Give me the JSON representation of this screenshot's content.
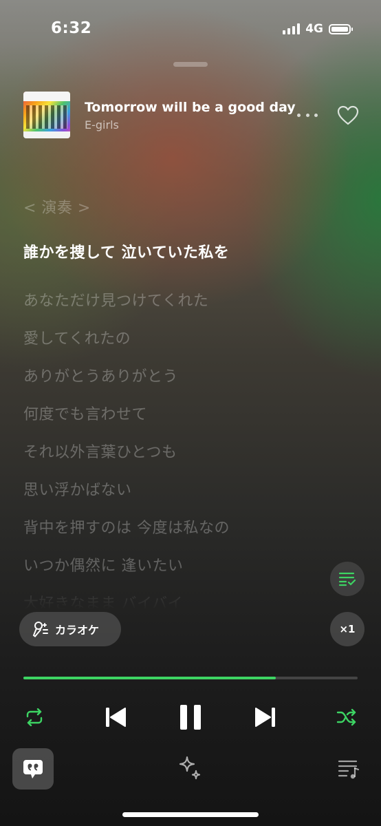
{
  "status_bar": {
    "time": "6:32",
    "network": "4G"
  },
  "track": {
    "title": "Tomorrow will be a good day",
    "artist": "E-girls",
    "liked": false
  },
  "lyrics": {
    "lines": [
      "< 演奏 >",
      "誰かを捜して 泣いていた私を",
      "あなただけ見つけてくれた",
      "愛してくれたの",
      "ありがとうありがとう",
      "何度でも言わせて",
      "それ以外言葉ひとつも",
      "思い浮かばない",
      "背中を押すのは 今度は私なの",
      "いつか偶然に 逢いたい",
      "大好きなまま バイバイ"
    ],
    "active_index": 1
  },
  "controls": {
    "karaoke_label": "カラオケ",
    "speed_label": "×1",
    "progress_fraction": 0.755,
    "repeat_enabled": true,
    "shuffle_enabled": true,
    "is_playing": true
  },
  "icons": {
    "lyrics_mode": "lyrics-list-icon",
    "karaoke": "microphone-sparkle-icon",
    "repeat": "repeat-icon",
    "previous": "skip-previous-icon",
    "pause": "pause-icon",
    "next": "skip-next-icon",
    "shuffle": "shuffle-icon",
    "tab_lyrics": "quote-bubble-icon",
    "tab_discover": "sparkle-icon",
    "tab_queue": "queue-music-icon"
  },
  "colors": {
    "accent": "#3dd463",
    "text_primary": "#ffffff",
    "text_dim": "rgba(255,255,255,0.28)"
  }
}
